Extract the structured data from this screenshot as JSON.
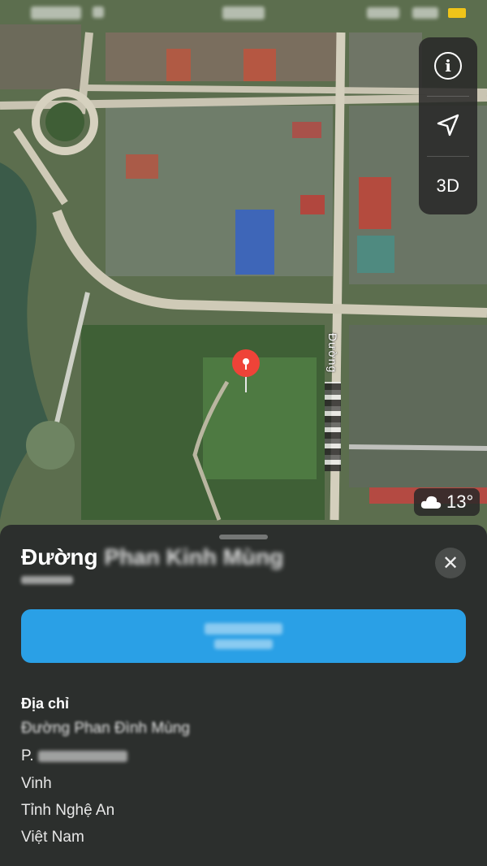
{
  "status_bar": {
    "text": ""
  },
  "map_controls": {
    "info_label": "i",
    "three_d_label": "3D"
  },
  "street_label": "Đường",
  "weather": {
    "temperature": "13°"
  },
  "place": {
    "title_prefix": "Đường",
    "title_rest": "Phan Kinh Mùng",
    "subtitle": "",
    "directions_line1": "",
    "directions_line2": ""
  },
  "address": {
    "heading": "Địa chỉ",
    "line1": "Đường Phan Đình Mùng",
    "line2_prefix": "P.",
    "line3": "Vinh",
    "line4": "Tỉnh Nghệ An",
    "line5": "Việt Nam"
  }
}
